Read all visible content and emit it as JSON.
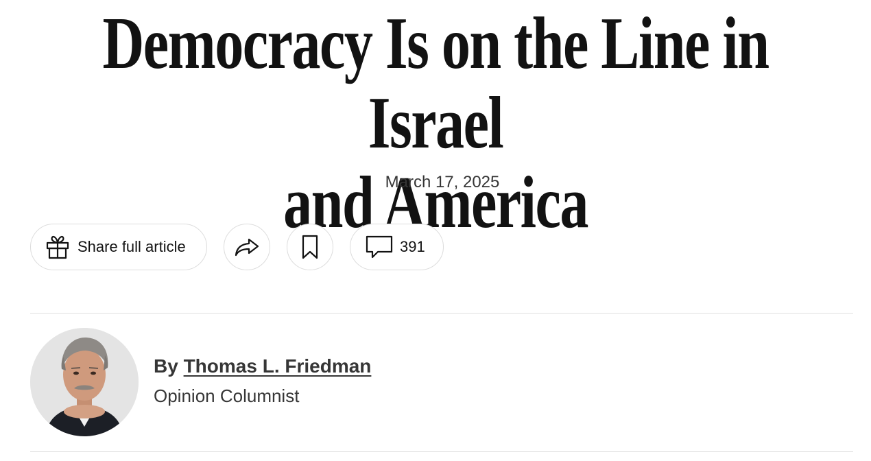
{
  "article": {
    "headline_line1": "Democracy Is on the Line in Israel",
    "headline_line2": "and America",
    "date": "March 17, 2025"
  },
  "toolbar": {
    "share_label": "Share full article",
    "share_icon": "gift-icon",
    "forward_icon": "share-arrow-icon",
    "save_icon": "bookmark-icon",
    "comments_icon": "comment-bubble-icon",
    "comments_count": "391"
  },
  "byline": {
    "prefix": "By",
    "author": "Thomas L. Friedman",
    "role": "Opinion Columnist"
  },
  "colors": {
    "text": "#121212",
    "secondary_text": "#363636",
    "border": "#dcdcdc",
    "divider": "#dfdfdf"
  }
}
